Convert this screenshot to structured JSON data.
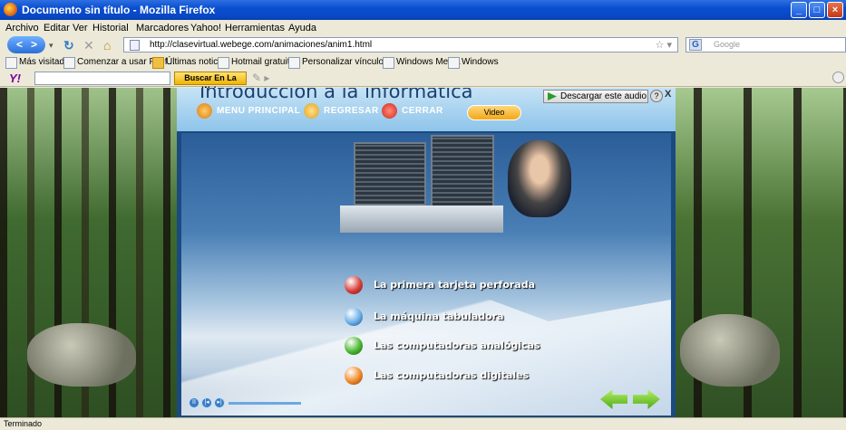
{
  "window": {
    "title": "Documento sin título - Mozilla Firefox",
    "minimize_glyph": "_",
    "maximize_glyph": "□",
    "close_glyph": "×"
  },
  "menu": {
    "items": [
      "Archivo",
      "Editar",
      "Ver",
      "Historial",
      "Marcadores",
      "Yahoo!",
      "Herramientas",
      "Ayuda"
    ]
  },
  "nav": {
    "back_glyph": "<",
    "forward_glyph": ">",
    "url": "http://clasevirtual.webege.com/animaciones/anim1.html",
    "search_placeholder": "Google",
    "search_engine_glyph": "G"
  },
  "bookmarks": {
    "items": [
      "Más visitados",
      "Comenzar a usar Firef...",
      "Últimas noticias",
      "Hotmail gratuito",
      "Personalizar vínculos",
      "Windows Media",
      "Windows"
    ]
  },
  "yahoo": {
    "logo": "Y!",
    "button": "Buscar En La Web"
  },
  "app": {
    "title": "Introducción a la informática",
    "nav": {
      "menu_principal": "MENU PRINCIPAL",
      "regresar": "REGRESAR",
      "cerrar": "CERRAR",
      "video": "Video"
    },
    "download": "Descargar este audio",
    "help_glyph": "?",
    "close_glyph": "X",
    "player": {
      "pause_glyph": "II",
      "prev_glyph": "|◂",
      "next_glyph": "▸|"
    },
    "topics": [
      {
        "label": "La primera tarjeta perforada",
        "color": "#d8403a"
      },
      {
        "label": "La máquina tabuladora",
        "color": "#6ab0e8"
      },
      {
        "label": "Las computadoras  analógicas",
        "color": "#4cb832"
      },
      {
        "label": "Las computadoras digitales",
        "color": "#f08a2a"
      }
    ]
  },
  "status": {
    "text": "Terminado"
  }
}
